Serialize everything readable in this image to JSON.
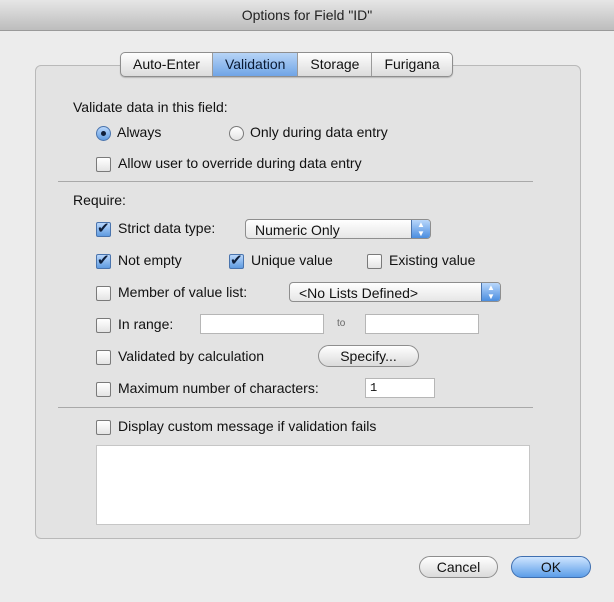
{
  "window": {
    "title": "Options for Field \"ID\""
  },
  "tabs": [
    {
      "label": "Auto-Enter",
      "active": false
    },
    {
      "label": "Validation",
      "active": true
    },
    {
      "label": "Storage",
      "active": false
    },
    {
      "label": "Furigana",
      "active": false
    }
  ],
  "validate": {
    "heading": "Validate data in this field:",
    "always_label": "Always",
    "only_entry_label": "Only during data entry",
    "override_label": "Allow user to override during data entry"
  },
  "require": {
    "heading": "Require:",
    "strict_label": "Strict data type:",
    "strict_value": "Numeric Only",
    "not_empty_label": "Not empty",
    "unique_label": "Unique value",
    "existing_label": "Existing value",
    "member_label": "Member of value list:",
    "member_value": "<No Lists Defined>",
    "range_label": "In range:",
    "range_to": "to",
    "range_from_value": "",
    "range_to_value": "",
    "calc_label": "Validated by calculation",
    "specify_label": "Specify...",
    "maxchars_label": "Maximum number of characters:",
    "maxchars_value": "1"
  },
  "message": {
    "label": "Display custom message if validation fails",
    "text": ""
  },
  "buttons": {
    "cancel": "Cancel",
    "ok": "OK"
  },
  "colors": {
    "accent": "#5f9be0",
    "window_bg": "#ececec"
  }
}
